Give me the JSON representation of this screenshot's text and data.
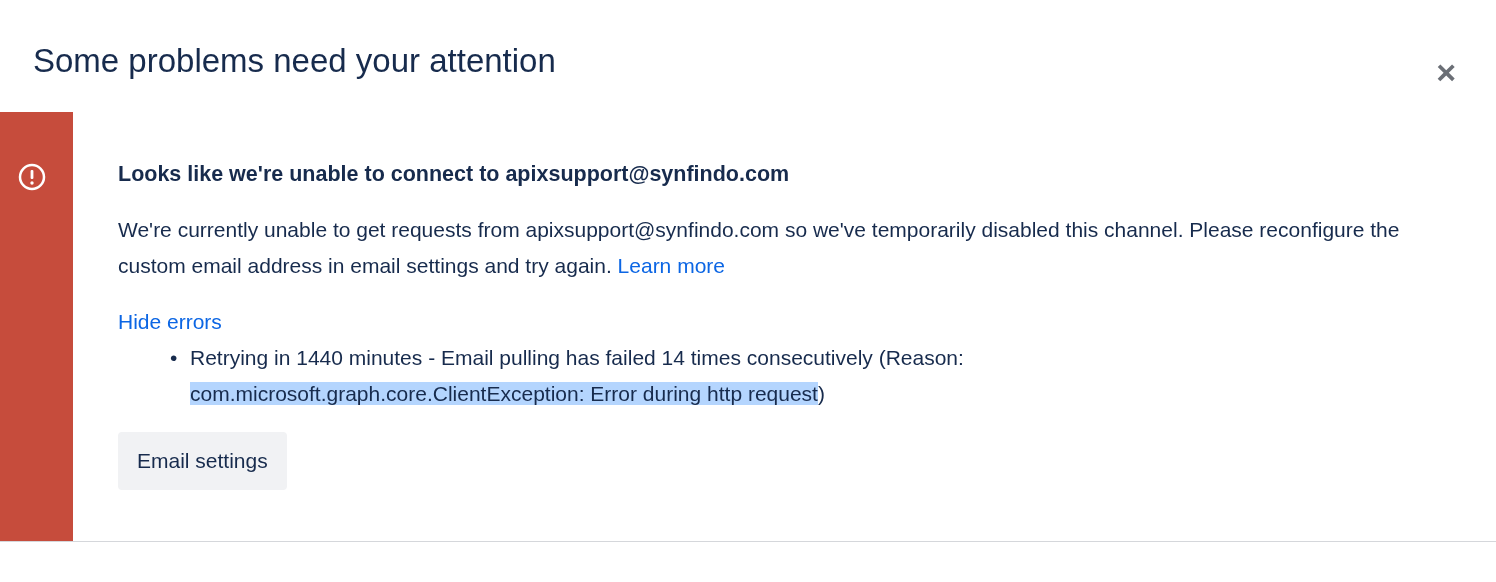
{
  "dialog": {
    "title": "Some problems need your attention",
    "close": "×"
  },
  "errors": [
    {
      "kind": "error",
      "heading": "Looks like we're unable to connect to apixsupport@synfindo.com",
      "message": "We're currently unable to get requests from apixsupport@synfindo.com so we've temporarily disabled this channel. Please reconfigure the custom email address in email settings and try again.",
      "link": "Learn more",
      "toggle": "Hide errors",
      "details": [
        {
          "marker": "•",
          "segments": [
            {
              "text": "Retrying in 1440 minutes - Email pulling has failed 14 times consecutively (Reason: ",
              "highlighted": false
            },
            {
              "text": "com.microsoft.graph.core.ClientException: Error during http request",
              "highlighted": true
            },
            {
              "text": ")",
              "highlighted": false
            }
          ]
        }
      ],
      "button": "Email settings"
    }
  ]
}
